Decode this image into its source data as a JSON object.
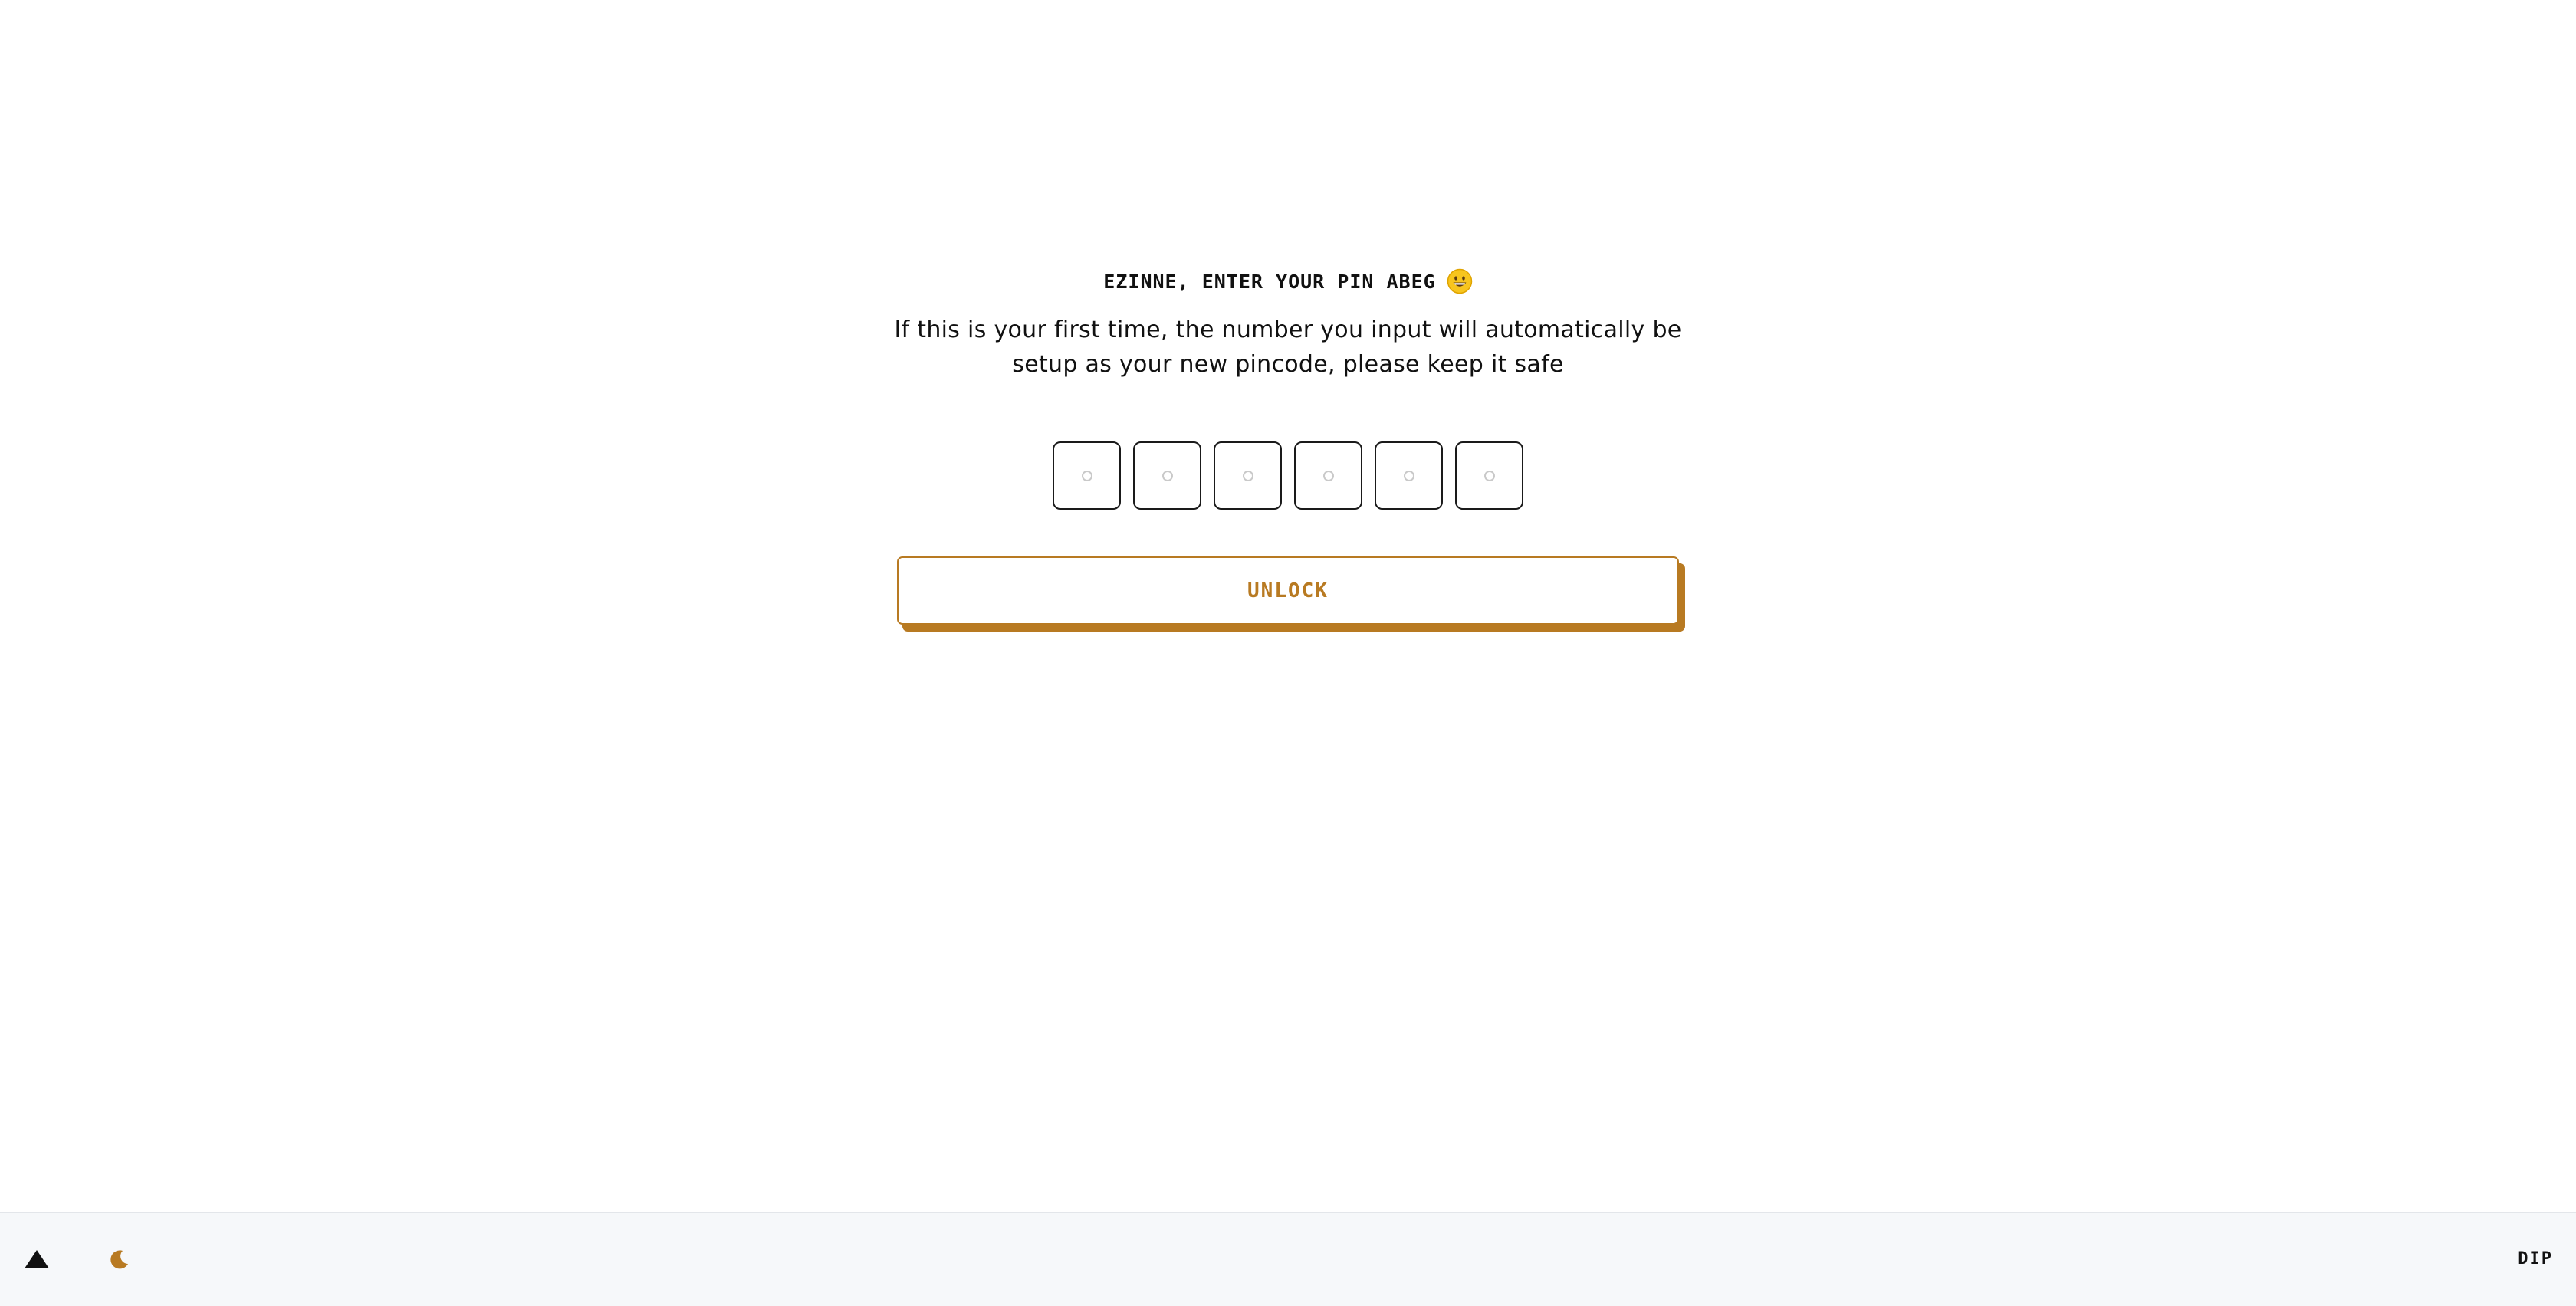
{
  "header": {
    "prompt": "EZINNE, ENTER YOUR PIN ABEG",
    "emoji_icon": "grinning-face-icon"
  },
  "description": {
    "line1": "If this is your first time, the number you input will automatically be",
    "line2": "setup as your new pincode, please keep it safe"
  },
  "pin": {
    "length": 6,
    "digits": [
      "",
      "",
      "",
      "",
      "",
      ""
    ]
  },
  "unlock_button": {
    "label": "UNLOCK"
  },
  "footer": {
    "logo_icon": "triangle-logo-icon",
    "theme_toggle_icon": "moon-icon",
    "brand": "DIP"
  },
  "colors": {
    "accent": "#b87a22",
    "text": "#111111",
    "footer_bg": "#f6f8fa",
    "pin_border": "#1a1a1a"
  }
}
